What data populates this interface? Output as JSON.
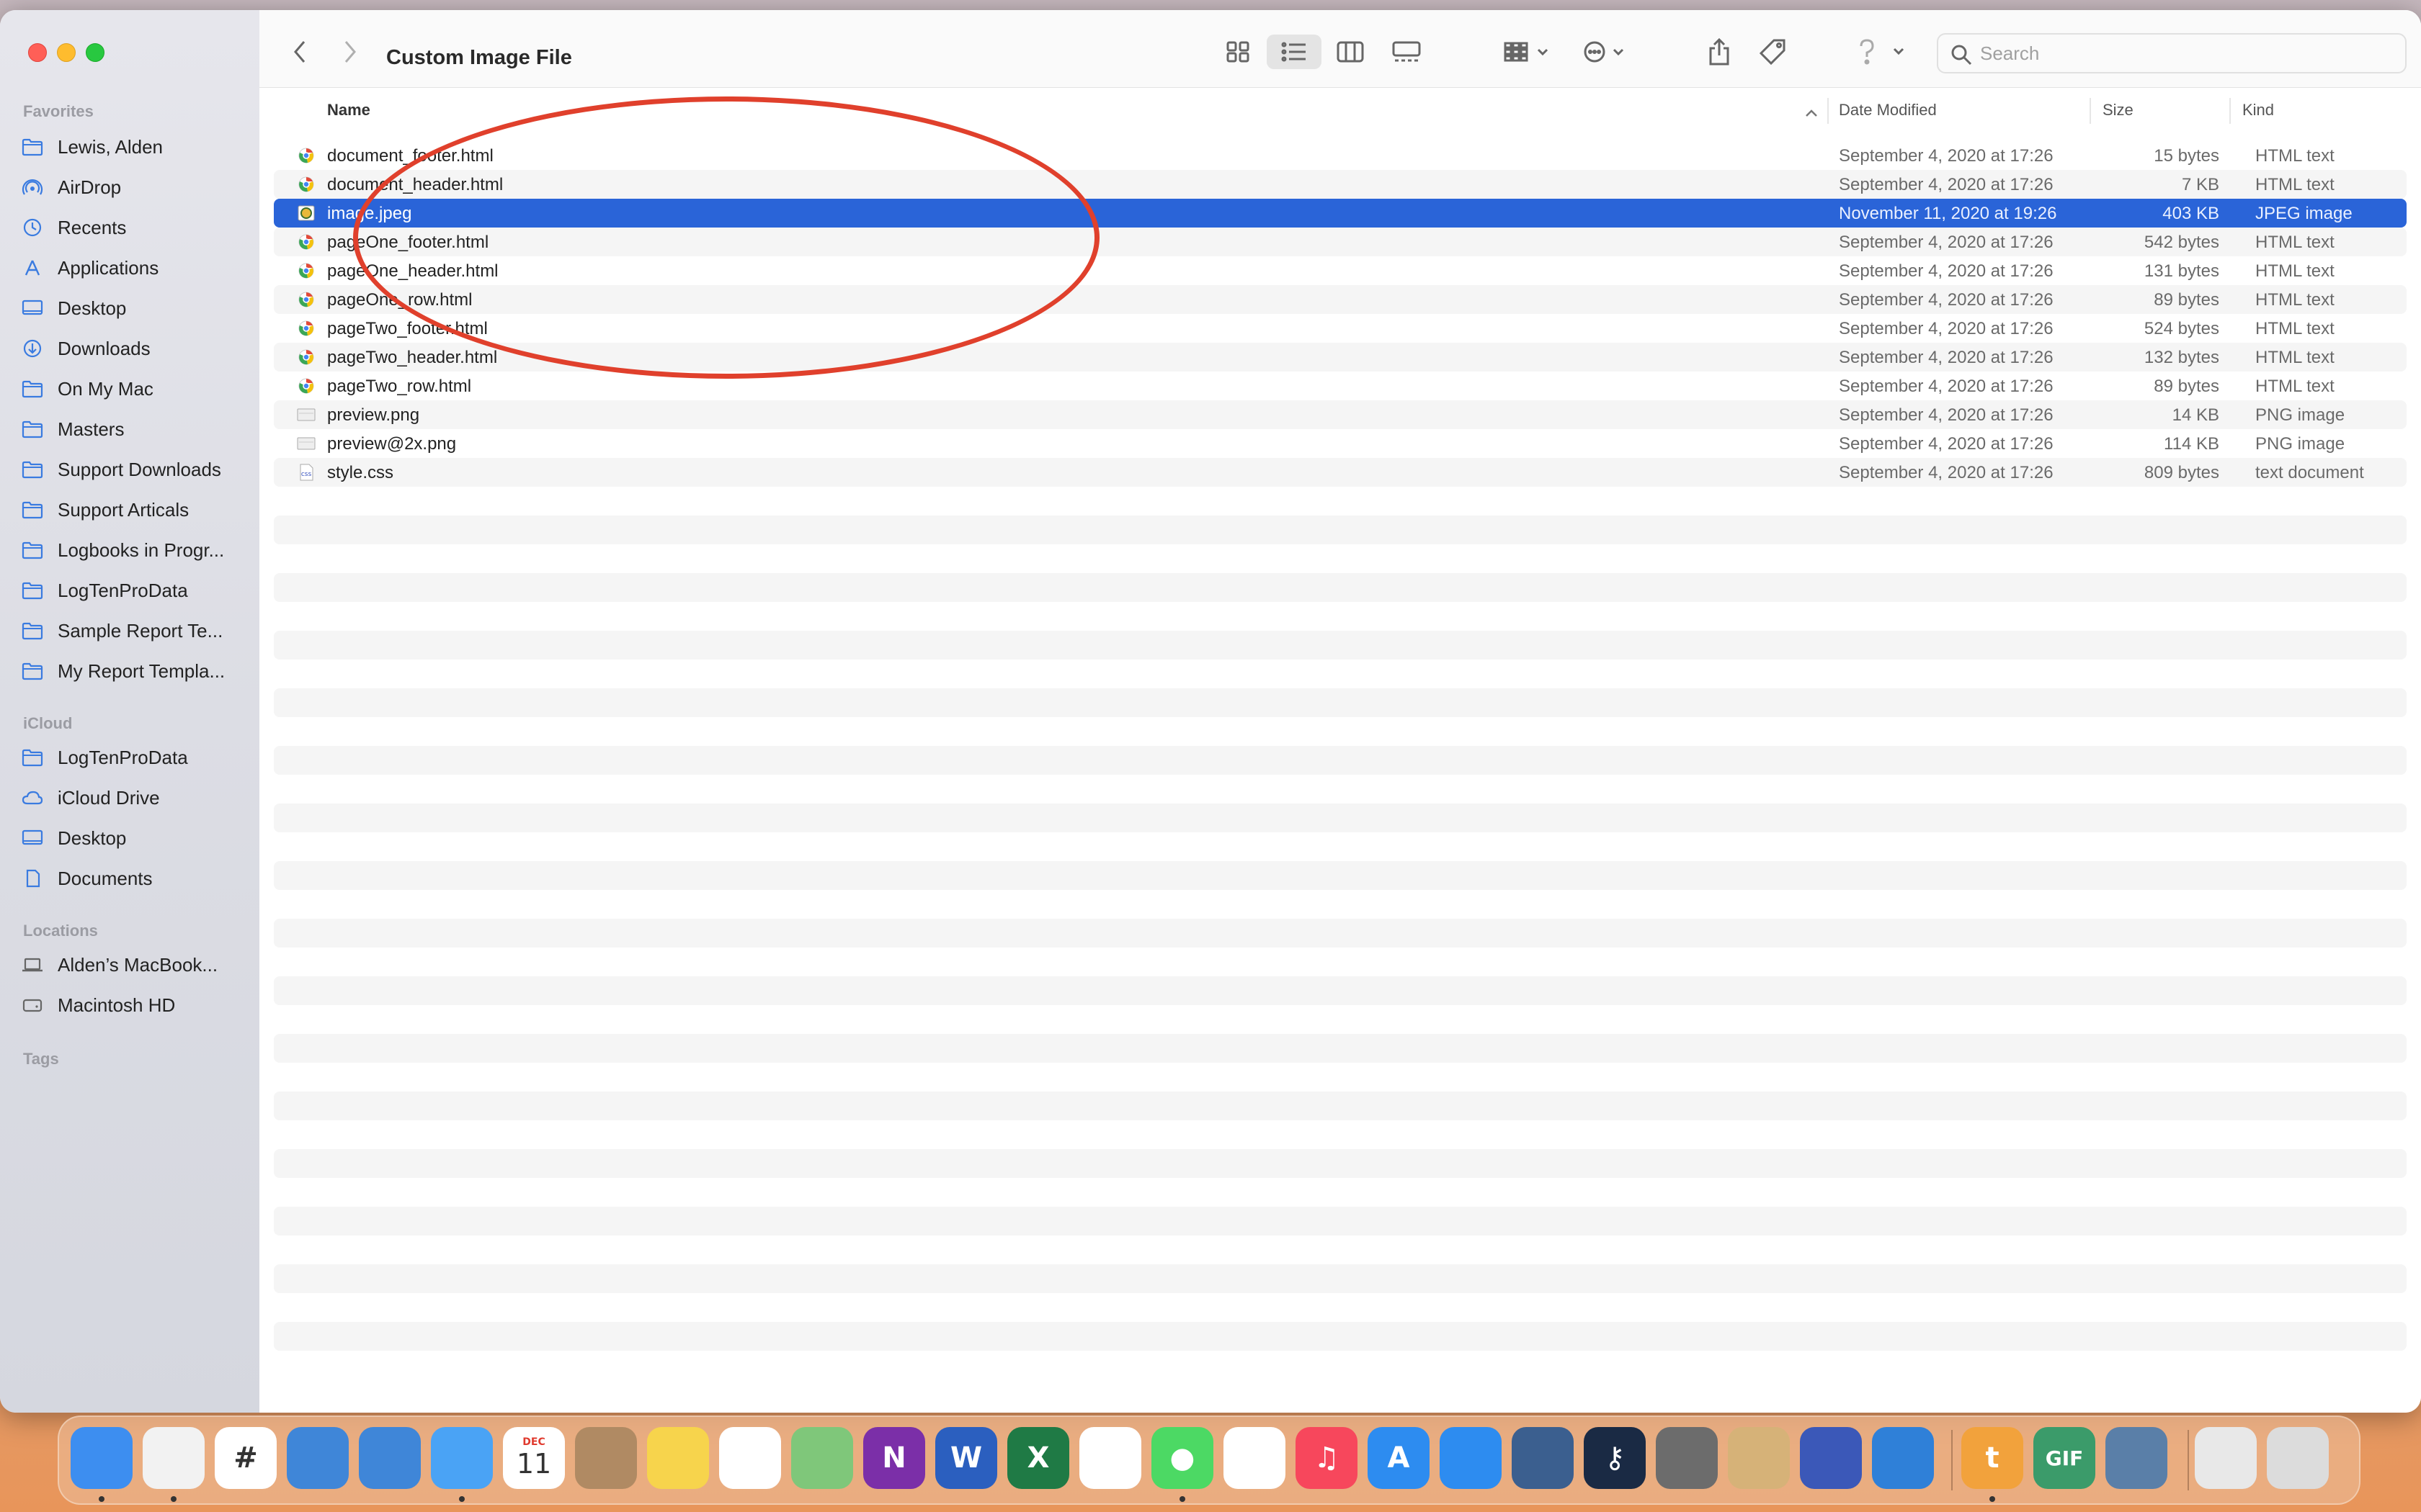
{
  "window": {
    "title": "Custom Image File",
    "search_placeholder": "Search"
  },
  "sidebar": {
    "favorites_header": "Favorites",
    "favorites": [
      {
        "label": "Lewis, Alden",
        "icon": "folder-icon"
      },
      {
        "label": "AirDrop",
        "icon": "airdrop-icon"
      },
      {
        "label": "Recents",
        "icon": "clock-icon"
      },
      {
        "label": "Applications",
        "icon": "applications-icon"
      },
      {
        "label": "Desktop",
        "icon": "desktop-icon"
      },
      {
        "label": "Downloads",
        "icon": "downloads-icon"
      },
      {
        "label": "On My Mac",
        "icon": "folder-icon"
      },
      {
        "label": "Masters",
        "icon": "folder-icon"
      },
      {
        "label": "Support Downloads",
        "icon": "folder-icon"
      },
      {
        "label": "Support Articals",
        "icon": "folder-icon"
      },
      {
        "label": "Logbooks in Progr...",
        "icon": "folder-icon"
      },
      {
        "label": "LogTenProData",
        "icon": "folder-icon"
      },
      {
        "label": "Sample Report Te...",
        "icon": "folder-icon"
      },
      {
        "label": "My Report Templa...",
        "icon": "folder-icon"
      }
    ],
    "icloud_header": "iCloud",
    "icloud": [
      {
        "label": "LogTenProData",
        "icon": "folder-icon"
      },
      {
        "label": "iCloud Drive",
        "icon": "cloud-icon"
      },
      {
        "label": "Desktop",
        "icon": "desktop-icon"
      },
      {
        "label": "Documents",
        "icon": "document-icon"
      }
    ],
    "locations_header": "Locations",
    "locations": [
      {
        "label": "Alden’s MacBook...",
        "icon": "laptop-icon"
      },
      {
        "label": "Macintosh HD",
        "icon": "disk-icon"
      }
    ],
    "tags_header": "Tags"
  },
  "columns": {
    "name": "Name",
    "date": "Date Modified",
    "size": "Size",
    "kind": "Kind"
  },
  "files": [
    {
      "name": "document_footer.html",
      "date": "September 4, 2020 at 17:26",
      "size": "15 bytes",
      "kind": "HTML text",
      "icon": "html-file-icon"
    },
    {
      "name": "document_header.html",
      "date": "September 4, 2020 at 17:26",
      "size": "7 KB",
      "kind": "HTML text",
      "icon": "html-file-icon"
    },
    {
      "name": "image.jpeg",
      "date": "November 11, 2020 at 19:26",
      "size": "403 KB",
      "kind": "JPEG image",
      "icon": "jpeg-file-icon",
      "selected": true
    },
    {
      "name": "pageOne_footer.html",
      "date": "September 4, 2020 at 17:26",
      "size": "542 bytes",
      "kind": "HTML text",
      "icon": "html-file-icon"
    },
    {
      "name": "pageOne_header.html",
      "date": "September 4, 2020 at 17:26",
      "size": "131 bytes",
      "kind": "HTML text",
      "icon": "html-file-icon"
    },
    {
      "name": "pageOne_row.html",
      "date": "September 4, 2020 at 17:26",
      "size": "89 bytes",
      "kind": "HTML text",
      "icon": "html-file-icon"
    },
    {
      "name": "pageTwo_footer.html",
      "date": "September 4, 2020 at 17:26",
      "size": "524 bytes",
      "kind": "HTML text",
      "icon": "html-file-icon"
    },
    {
      "name": "pageTwo_header.html",
      "date": "September 4, 2020 at 17:26",
      "size": "132 bytes",
      "kind": "HTML text",
      "icon": "html-file-icon"
    },
    {
      "name": "pageTwo_row.html",
      "date": "September 4, 2020 at 17:26",
      "size": "89 bytes",
      "kind": "HTML text",
      "icon": "html-file-icon"
    },
    {
      "name": "preview.png",
      "date": "September 4, 2020 at 17:26",
      "size": "14 KB",
      "kind": "PNG image",
      "icon": "png-file-icon"
    },
    {
      "name": "preview@2x.png",
      "date": "September 4, 2020 at 17:26",
      "size": "114 KB",
      "kind": "PNG image",
      "icon": "png-file-icon"
    },
    {
      "name": "style.css",
      "date": "September 4, 2020 at 17:26",
      "size": "809 bytes",
      "kind": "text document",
      "icon": "css-file-icon"
    }
  ],
  "colors": {
    "selection": "#2a64d8",
    "annotation": "#e0402c"
  },
  "dock": {
    "calendar_month": "DEC",
    "calendar_day": "11",
    "apps": [
      "finder-icon",
      "chrome-icon",
      "slack-icon",
      "logten-icon",
      "logten-icon",
      "mail-icon",
      "calendar-icon",
      "contacts-icon",
      "notes-icon",
      "reminders-icon",
      "maps-icon",
      "onenote-icon",
      "word-icon",
      "excel-icon",
      "photos-icon",
      "messages-icon",
      "numbers-icon",
      "music-icon",
      "app-store-icon",
      "safari-icon",
      "compass-icon",
      "keychain-icon",
      "system-preferences-icon",
      "archive-utility-icon",
      "tower-icon",
      "vscode-icon",
      "typora-icon",
      "gif-brewery-icon",
      "preview-icon",
      "downloads-stack-icon",
      "trash-icon"
    ]
  }
}
